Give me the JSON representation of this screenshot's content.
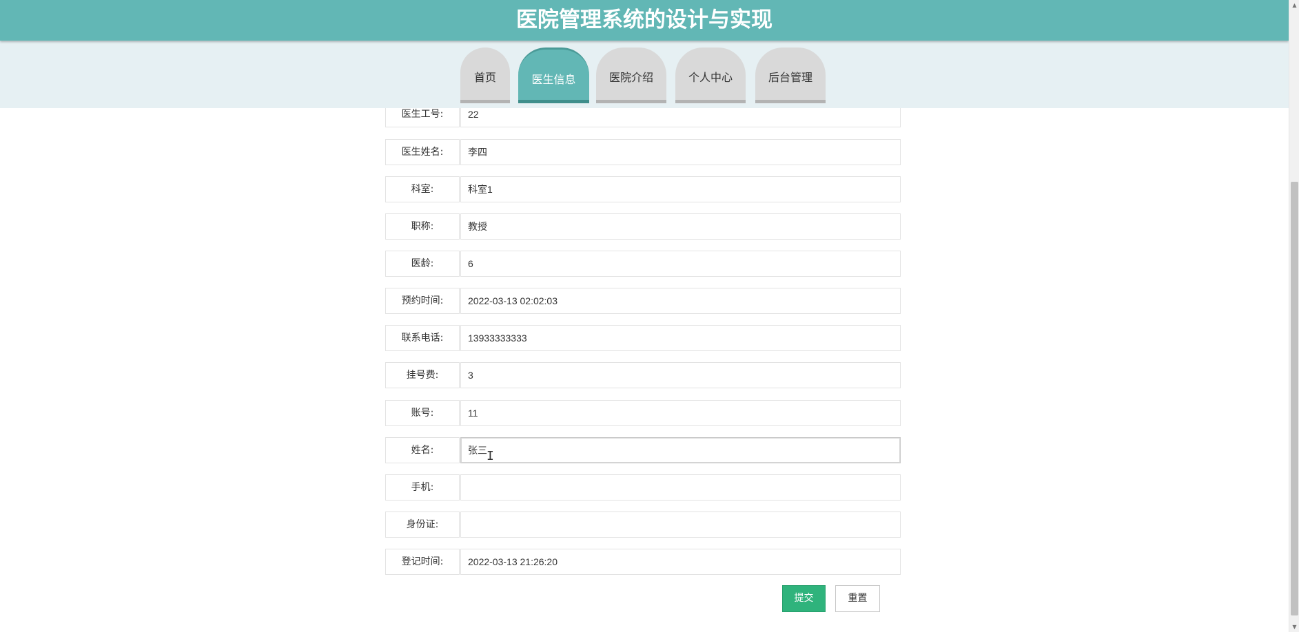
{
  "header": {
    "title": "医院管理系统的设计与实现"
  },
  "nav": {
    "tabs": [
      {
        "label": "首页"
      },
      {
        "label": "医生信息"
      },
      {
        "label": "医院介绍"
      },
      {
        "label": "个人中心"
      },
      {
        "label": "后台管理"
      }
    ],
    "active_tab": "医生信息"
  },
  "form": {
    "fields": [
      {
        "label": "医生工号:",
        "value": "22"
      },
      {
        "label": "医生姓名:",
        "value": "李四"
      },
      {
        "label": "科室:",
        "value": "科室1"
      },
      {
        "label": "职称:",
        "value": "教授"
      },
      {
        "label": "医龄:",
        "value": "6"
      },
      {
        "label": "预约时间:",
        "value": "2022-03-13 02:02:03"
      },
      {
        "label": "联系电话:",
        "value": "13933333333"
      },
      {
        "label": "挂号费:",
        "value": "3"
      },
      {
        "label": "账号:",
        "value": "11"
      },
      {
        "label": "姓名:",
        "value": "张三"
      },
      {
        "label": "手机:",
        "value": ""
      },
      {
        "label": "身份证:",
        "value": ""
      },
      {
        "label": "登记时间:",
        "value": "2022-03-13 21:26:20"
      }
    ],
    "submit_label": "提交",
    "reset_label": "重置"
  },
  "colors": {
    "header_bg": "#62b7b5",
    "nav_bg": "#e6f0f3",
    "submit_bg": "#2fb37c"
  }
}
